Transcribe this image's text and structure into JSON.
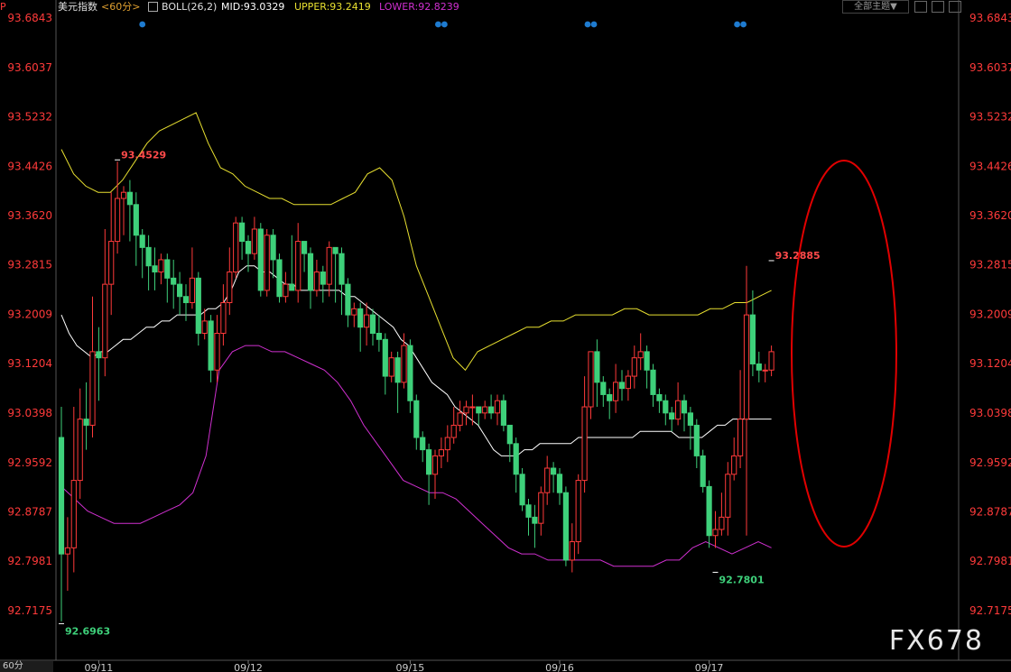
{
  "header": {
    "symbol": "美元指数",
    "period": "<60分>",
    "indicator": "BOLL(26,2)",
    "mid": "MID:93.0329",
    "upper": "UPPER:93.2419",
    "lower": "LOWER:92.8239",
    "theme_button": "全部主题▼"
  },
  "watermark": "FX678",
  "period_tab": "60分",
  "colors": {
    "up": "#ff3a3a",
    "down": "#3ed07a",
    "mid": "#ffffff",
    "upper": "#e8e030",
    "lower": "#d030d0",
    "axis_text": "#ff3a3a",
    "annotation_ellipse": "#e00000",
    "event_dots": "#1e7bd0"
  },
  "chart_data": {
    "type": "candlestick",
    "title": "美元指数",
    "ylim": [
      92.65,
      93.7
    ],
    "y_ticks": [
      "93.6843",
      "93.6037",
      "93.5232",
      "93.4426",
      "93.3620",
      "93.2815",
      "93.2009",
      "93.1204",
      "93.0398",
      "92.9592",
      "92.8787",
      "92.7981",
      "92.7175"
    ],
    "x_labels": [
      {
        "label": "09/11",
        "index": 6
      },
      {
        "label": "09/12",
        "index": 30
      },
      {
        "label": "09/15",
        "index": 56
      },
      {
        "label": "09/16",
        "index": 80
      },
      {
        "label": "09/17",
        "index": 104
      }
    ],
    "candles": [
      [
        93.0,
        92.81,
        93.05,
        92.7
      ],
      [
        92.81,
        92.82,
        92.87,
        92.75
      ],
      [
        92.82,
        92.93,
        93.05,
        92.78
      ],
      [
        92.93,
        93.03,
        93.08,
        92.9
      ],
      [
        93.03,
        93.02,
        93.09,
        92.98
      ],
      [
        93.02,
        93.14,
        93.23,
        93.0
      ],
      [
        93.14,
        93.13,
        93.18,
        93.06
      ],
      [
        93.13,
        93.25,
        93.34,
        93.1
      ],
      [
        93.25,
        93.32,
        93.4,
        93.2
      ],
      [
        93.32,
        93.39,
        93.45,
        93.3
      ],
      [
        93.39,
        93.4,
        93.41,
        93.33
      ],
      [
        93.4,
        93.38,
        93.42,
        93.32
      ],
      [
        93.38,
        93.33,
        93.4,
        93.28
      ],
      [
        93.33,
        93.31,
        93.34,
        93.26
      ],
      [
        93.31,
        93.28,
        93.33,
        93.24
      ],
      [
        93.28,
        93.27,
        93.31,
        93.24
      ],
      [
        93.27,
        93.29,
        93.3,
        93.25
      ],
      [
        93.29,
        93.26,
        93.3,
        93.22
      ],
      [
        93.26,
        93.25,
        93.29,
        93.21
      ],
      [
        93.25,
        93.23,
        93.27,
        93.2
      ],
      [
        93.23,
        93.22,
        93.25,
        93.19
      ],
      [
        93.22,
        93.26,
        93.31,
        93.21
      ],
      [
        93.26,
        93.17,
        93.27,
        93.15
      ],
      [
        93.17,
        93.19,
        93.21,
        93.16
      ],
      [
        93.19,
        93.11,
        93.2,
        93.09
      ],
      [
        93.11,
        93.17,
        93.2,
        93.09
      ],
      [
        93.17,
        93.22,
        93.25,
        93.15
      ],
      [
        93.22,
        93.27,
        93.31,
        93.2
      ],
      [
        93.27,
        93.35,
        93.36,
        93.26
      ],
      [
        93.35,
        93.32,
        93.36,
        93.29
      ],
      [
        93.32,
        93.3,
        93.33,
        93.27
      ],
      [
        93.3,
        93.34,
        93.36,
        93.29
      ],
      [
        93.34,
        93.24,
        93.35,
        93.23
      ],
      [
        93.24,
        93.33,
        93.34,
        93.23
      ],
      [
        93.33,
        93.29,
        93.34,
        93.26
      ],
      [
        93.29,
        93.23,
        93.3,
        93.22
      ],
      [
        93.23,
        93.25,
        93.27,
        93.22
      ],
      [
        93.25,
        93.24,
        93.33,
        93.24
      ],
      [
        93.24,
        93.32,
        93.35,
        93.22
      ],
      [
        93.32,
        93.3,
        93.32,
        93.27
      ],
      [
        93.3,
        93.24,
        93.31,
        93.21
      ],
      [
        93.24,
        93.27,
        93.29,
        93.23
      ],
      [
        93.27,
        93.25,
        93.28,
        93.22
      ],
      [
        93.25,
        93.31,
        93.32,
        93.23
      ],
      [
        93.31,
        93.3,
        93.31,
        93.22
      ],
      [
        93.3,
        93.25,
        93.31,
        93.2
      ],
      [
        93.25,
        93.2,
        93.26,
        93.18
      ],
      [
        93.2,
        93.21,
        93.22,
        93.18
      ],
      [
        93.21,
        93.18,
        93.22,
        93.14
      ],
      [
        93.18,
        93.2,
        93.22,
        93.15
      ],
      [
        93.2,
        93.17,
        93.21,
        93.15
      ],
      [
        93.17,
        93.16,
        93.2,
        93.14
      ],
      [
        93.16,
        93.1,
        93.17,
        93.07
      ],
      [
        93.1,
        93.13,
        93.14,
        93.09
      ],
      [
        93.13,
        93.09,
        93.14,
        93.04
      ],
      [
        93.09,
        93.15,
        93.17,
        93.08
      ],
      [
        93.15,
        93.06,
        93.16,
        93.04
      ],
      [
        93.06,
        93.0,
        93.07,
        92.98
      ],
      [
        93.0,
        92.98,
        93.01,
        92.96
      ],
      [
        92.98,
        92.94,
        92.99,
        92.89
      ],
      [
        92.94,
        92.97,
        92.98,
        92.9
      ],
      [
        92.97,
        92.98,
        93.0,
        92.95
      ],
      [
        92.98,
        93.0,
        93.02,
        92.96
      ],
      [
        93.0,
        93.02,
        93.05,
        92.99
      ],
      [
        93.02,
        93.04,
        93.06,
        93.01
      ],
      [
        93.04,
        93.05,
        93.06,
        93.02
      ],
      [
        93.05,
        93.05,
        93.07,
        93.02
      ],
      [
        93.05,
        93.04,
        93.05,
        93.02
      ],
      [
        93.04,
        93.05,
        93.06,
        93.03
      ],
      [
        93.05,
        93.04,
        93.07,
        93.03
      ],
      [
        93.04,
        93.06,
        93.07,
        93.02
      ],
      [
        93.06,
        93.02,
        93.07,
        93.01
      ],
      [
        93.02,
        92.99,
        93.02,
        92.96
      ],
      [
        92.99,
        92.94,
        93.0,
        92.91
      ],
      [
        92.94,
        92.89,
        92.95,
        92.88
      ],
      [
        92.89,
        92.87,
        92.9,
        92.84
      ],
      [
        92.87,
        92.86,
        92.89,
        92.82
      ],
      [
        92.86,
        92.91,
        92.92,
        92.84
      ],
      [
        92.91,
        92.95,
        92.97,
        92.89
      ],
      [
        92.95,
        92.94,
        92.96,
        92.91
      ],
      [
        92.94,
        92.91,
        92.95,
        92.89
      ],
      [
        92.91,
        92.8,
        92.92,
        92.79
      ],
      [
        92.8,
        92.83,
        92.86,
        92.78
      ],
      [
        92.83,
        92.93,
        92.94,
        92.81
      ],
      [
        92.93,
        93.05,
        93.1,
        92.91
      ],
      [
        93.05,
        93.14,
        93.14,
        93.03
      ],
      [
        93.14,
        93.09,
        93.16,
        93.05
      ],
      [
        93.09,
        93.07,
        93.1,
        93.05
      ],
      [
        93.07,
        93.06,
        93.08,
        93.03
      ],
      [
        93.06,
        93.09,
        93.12,
        93.04
      ],
      [
        93.09,
        93.08,
        93.11,
        93.06
      ],
      [
        93.08,
        93.1,
        93.11,
        93.06
      ],
      [
        93.1,
        93.13,
        93.15,
        93.08
      ],
      [
        93.13,
        93.14,
        93.17,
        93.11
      ],
      [
        93.14,
        93.11,
        93.15,
        93.08
      ],
      [
        93.11,
        93.07,
        93.12,
        93.05
      ],
      [
        93.07,
        93.06,
        93.08,
        93.04
      ],
      [
        93.06,
        93.04,
        93.07,
        93.02
      ],
      [
        93.04,
        93.03,
        93.05,
        93.01
      ],
      [
        93.03,
        93.06,
        93.09,
        93.02
      ],
      [
        93.06,
        93.04,
        93.07,
        93.01
      ],
      [
        93.04,
        93.02,
        93.05,
        92.98
      ],
      [
        93.02,
        92.97,
        93.03,
        92.95
      ],
      [
        92.97,
        92.92,
        92.98,
        92.91
      ],
      [
        92.92,
        92.84,
        92.93,
        92.82
      ],
      [
        92.84,
        92.85,
        92.88,
        92.82
      ],
      [
        92.85,
        92.87,
        92.91,
        92.84
      ],
      [
        92.87,
        92.94,
        92.96,
        92.84
      ],
      [
        92.94,
        92.97,
        93.0,
        92.93
      ],
      [
        92.97,
        93.03,
        93.11,
        92.95
      ],
      [
        93.03,
        93.2,
        93.28,
        92.84
      ],
      [
        93.2,
        93.12,
        93.24,
        93.1
      ],
      [
        93.12,
        93.11,
        93.14,
        93.09
      ],
      [
        93.11,
        93.11,
        93.12,
        93.09
      ],
      [
        93.11,
        93.14,
        93.15,
        93.1
      ]
    ],
    "boll_mid": [
      93.2,
      93.17,
      93.15,
      93.14,
      93.13,
      93.14,
      93.14,
      93.15,
      93.16,
      93.16,
      93.17,
      93.18,
      93.18,
      93.19,
      93.19,
      93.2,
      93.2,
      93.2,
      93.2,
      93.21,
      93.21,
      93.22,
      93.24,
      93.27,
      93.28,
      93.28,
      93.27,
      93.27,
      93.26,
      93.25,
      93.25,
      93.24,
      93.24,
      93.24,
      93.24,
      93.24,
      93.24,
      93.23,
      93.23,
      93.22,
      93.21,
      93.2,
      93.19,
      93.18,
      93.16,
      93.15,
      93.13,
      93.11,
      93.09,
      93.08,
      93.07,
      93.05,
      93.04,
      93.03,
      93.02,
      93.0,
      92.98,
      92.97,
      92.97,
      92.97,
      92.98,
      92.98,
      92.99,
      92.99,
      92.99,
      92.99,
      92.99,
      93.0,
      93.0,
      93.0,
      93.0,
      93.0,
      93.0,
      93.0,
      93.0,
      93.01,
      93.01,
      93.01,
      93.01,
      93.01,
      93.0,
      93.0,
      93.0,
      93.0,
      93.01,
      93.02,
      93.02,
      93.03,
      93.03,
      93.03,
      93.03,
      93.03,
      93.03
    ],
    "boll_upper": [
      93.47,
      93.43,
      93.41,
      93.4,
      93.4,
      93.42,
      93.45,
      93.48,
      93.5,
      93.51,
      93.52,
      93.53,
      93.48,
      93.44,
      93.43,
      93.41,
      93.4,
      93.39,
      93.39,
      93.38,
      93.38,
      93.38,
      93.38,
      93.39,
      93.4,
      93.43,
      93.44,
      93.42,
      93.36,
      93.28,
      93.23,
      93.18,
      93.13,
      93.11,
      93.14,
      93.15,
      93.16,
      93.17,
      93.18,
      93.18,
      93.19,
      93.19,
      93.2,
      93.2,
      93.2,
      93.2,
      93.21,
      93.21,
      93.2,
      93.2,
      93.2,
      93.2,
      93.2,
      93.21,
      93.21,
      93.22,
      93.22,
      93.23,
      93.24
    ],
    "boll_lower": [
      92.92,
      92.9,
      92.88,
      92.87,
      92.86,
      92.86,
      92.86,
      92.87,
      92.88,
      92.89,
      92.91,
      92.97,
      93.11,
      93.14,
      93.15,
      93.15,
      93.14,
      93.14,
      93.13,
      93.12,
      93.11,
      93.09,
      93.06,
      93.02,
      92.99,
      92.96,
      92.93,
      92.92,
      92.91,
      92.91,
      92.9,
      92.88,
      92.86,
      92.84,
      92.82,
      92.81,
      92.81,
      92.8,
      92.8,
      92.8,
      92.8,
      92.8,
      92.79,
      92.79,
      92.79,
      92.79,
      92.8,
      92.8,
      92.82,
      92.83,
      92.82,
      92.81,
      92.82,
      92.83,
      92.82
    ],
    "annotations": [
      {
        "text": "93.4529",
        "value": 93.4529,
        "index": 9,
        "kind": "high"
      },
      {
        "text": "92.6963",
        "value": 92.6963,
        "index": 0,
        "kind": "low"
      },
      {
        "text": "93.2885",
        "value": 93.2885,
        "index": 114,
        "kind": "high"
      },
      {
        "text": "92.7801",
        "value": 92.7801,
        "index": 105,
        "kind": "low"
      }
    ],
    "event_markers": [
      {
        "index": 13,
        "count": 1
      },
      {
        "index": 61,
        "count": 2
      },
      {
        "index": 85,
        "count": 2
      },
      {
        "index": 109,
        "count": 2
      }
    ]
  }
}
